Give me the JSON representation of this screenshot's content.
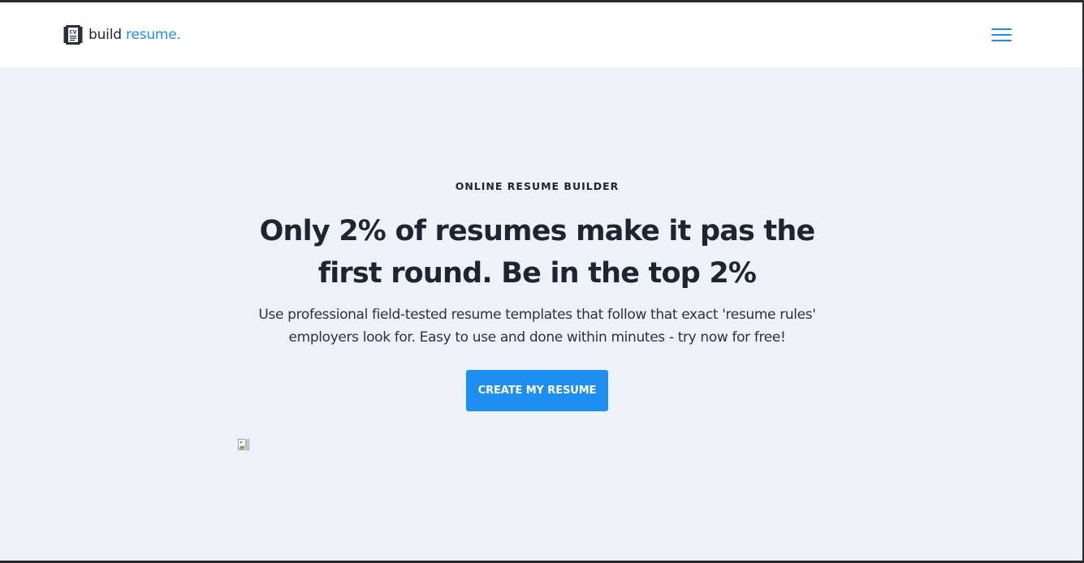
{
  "header": {
    "logo_word1": "build",
    "logo_word2": "resume.",
    "logo_icon_text": "CV",
    "menu_icon": "hamburger-menu-icon"
  },
  "hero": {
    "eyebrow": "ONLINE RESUME BUILDER",
    "headline": "Only 2% of resumes make it pas the first round. Be in the top 2%",
    "subtext": "Use professional field-tested resume templates that follow that exact 'resume rules' employers look for. Easy to use and done within minutes - try now for free!",
    "cta_label": "CREATE MY RESUME",
    "image_icon": "broken-image-icon"
  },
  "colors": {
    "accent": "#1f8ef1",
    "text_dark": "#1f2433",
    "background": "#eef1f8",
    "header_bg": "#ffffff"
  }
}
